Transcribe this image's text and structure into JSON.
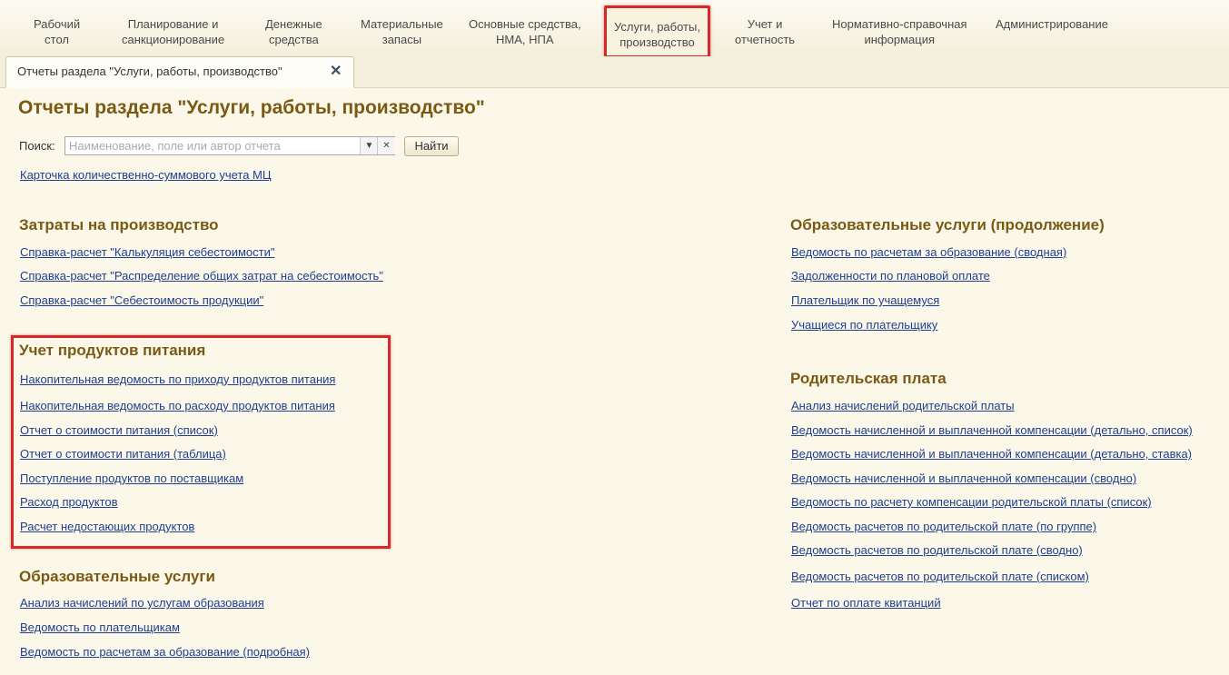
{
  "nav": {
    "items": [
      {
        "label_1": "Рабочий",
        "label_2": "стол"
      },
      {
        "label_1": "Планирование и",
        "label_2": "санкционирование"
      },
      {
        "label_1": "Денежные",
        "label_2": "средства"
      },
      {
        "label_1": "Материальные",
        "label_2": "запасы"
      },
      {
        "label_1": "Основные средства,",
        "label_2": "НМА, НПА"
      },
      {
        "label_1": "Услуги, работы,",
        "label_2": "производство"
      },
      {
        "label_1": "Учет и",
        "label_2": "отчетность"
      },
      {
        "label_1": "Нормативно-справочная",
        "label_2": "информация"
      },
      {
        "label_1": "Администрирование",
        "label_2": ""
      }
    ],
    "active_index": 5
  },
  "tab": {
    "label": "Отчеты раздела \"Услуги, работы, производство\"",
    "close_glyph": "✕"
  },
  "page": {
    "title": "Отчеты раздела \"Услуги, работы, производство\""
  },
  "search": {
    "label": "Поиск:",
    "value": "",
    "placeholder": "Наименование, поле или автор отчета",
    "dropdown_glyph": "▼",
    "clear_glyph": "✕",
    "button_label": "Найти"
  },
  "top_link": "Карточка количественно-суммового учета МЦ",
  "groups": {
    "costs": {
      "title": "Затраты на производство",
      "items": [
        "Справка-расчет \"Калькуляция себестоимости\"",
        "Справка-расчет \"Распределение общих затрат на себестоимость\"",
        "Справка-расчет \"Себестоимость продукции\""
      ]
    },
    "food": {
      "title": "Учет продуктов питания",
      "items": [
        "Накопительная ведомость по приходу продуктов питания",
        "Накопительная ведомость по расходу продуктов питания",
        "Отчет о стоимости питания (список)",
        "Отчет о стоимости питания (таблица)",
        "Поступление продуктов по поставщикам",
        "Расход продуктов",
        "Расчет недостающих продуктов"
      ]
    },
    "edu": {
      "title": "Образовательные услуги",
      "items": [
        "Анализ начислений по услугам образования",
        "Ведомость по плательщикам",
        "Ведомость по расчетам за образование (подробная)"
      ]
    },
    "edu_cont": {
      "title": "Образовательные услуги (продолжение)",
      "items": [
        "Ведомость по расчетам за образование (сводная)",
        "Задолженности по плановой оплате",
        "Плательщик по учащемуся",
        "Учащиеся по плательщику"
      ]
    },
    "parent": {
      "title": "Родительская плата",
      "items": [
        "Анализ начислений родительской платы",
        "Ведомость начисленной и выплаченной компенсации (детально, список)",
        "Ведомость начисленной и выплаченной компенсации (детально, ставка)",
        "Ведомость начисленной и выплаченной компенсации (сводно)",
        "Ведомость по расчету компенсации родительской платы (список)",
        "Ведомость расчетов по родительской плате (по группе)",
        "Ведомость расчетов по родительской плате (сводно)",
        "Ведомость расчетов по родительской плате (списком)",
        "Отчет по оплате квитанций"
      ]
    }
  },
  "colors": {
    "accent_title": "#7a5a12",
    "link": "#1f3e8f",
    "highlight": "#d42a2a",
    "background": "#fbf8ea"
  }
}
